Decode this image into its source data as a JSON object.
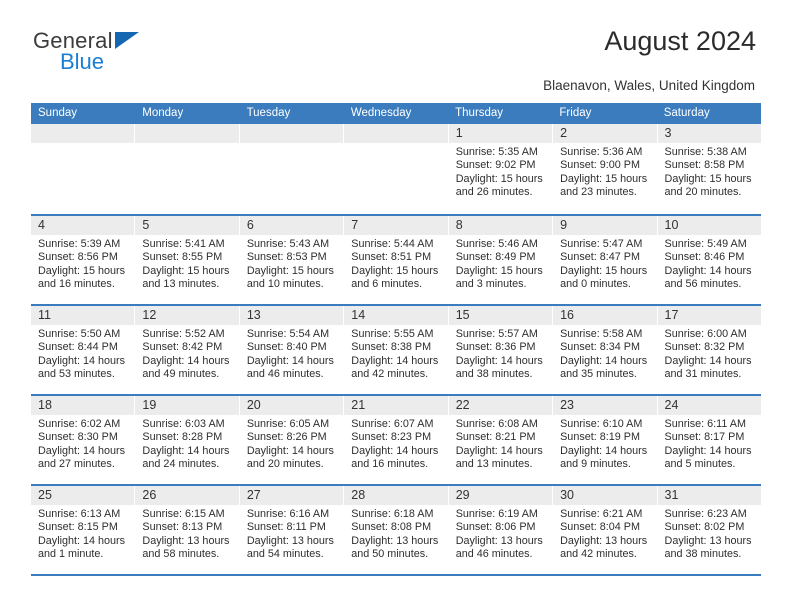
{
  "brand": {
    "name_top": "General",
    "name_bottom": "Blue",
    "triangle_icon": "blue-triangle-icon",
    "color_dark": "#3c3c3c",
    "color_blue": "#1a7fd4"
  },
  "header": {
    "title": "August 2024",
    "subtitle": "Blaenavon, Wales, United Kingdom"
  },
  "calendar": {
    "header_bg": "#3a7cbe",
    "day_band_bg": "#ececec",
    "day_names": [
      "Sunday",
      "Monday",
      "Tuesday",
      "Wednesday",
      "Thursday",
      "Friday",
      "Saturday"
    ],
    "weeks": [
      [
        {
          "day": "",
          "lines": []
        },
        {
          "day": "",
          "lines": []
        },
        {
          "day": "",
          "lines": []
        },
        {
          "day": "",
          "lines": []
        },
        {
          "day": "1",
          "lines": [
            "Sunrise: 5:35 AM",
            "Sunset: 9:02 PM",
            "Daylight: 15 hours",
            "and 26 minutes."
          ]
        },
        {
          "day": "2",
          "lines": [
            "Sunrise: 5:36 AM",
            "Sunset: 9:00 PM",
            "Daylight: 15 hours",
            "and 23 minutes."
          ]
        },
        {
          "day": "3",
          "lines": [
            "Sunrise: 5:38 AM",
            "Sunset: 8:58 PM",
            "Daylight: 15 hours",
            "and 20 minutes."
          ]
        }
      ],
      [
        {
          "day": "4",
          "lines": [
            "Sunrise: 5:39 AM",
            "Sunset: 8:56 PM",
            "Daylight: 15 hours",
            "and 16 minutes."
          ]
        },
        {
          "day": "5",
          "lines": [
            "Sunrise: 5:41 AM",
            "Sunset: 8:55 PM",
            "Daylight: 15 hours",
            "and 13 minutes."
          ]
        },
        {
          "day": "6",
          "lines": [
            "Sunrise: 5:43 AM",
            "Sunset: 8:53 PM",
            "Daylight: 15 hours",
            "and 10 minutes."
          ]
        },
        {
          "day": "7",
          "lines": [
            "Sunrise: 5:44 AM",
            "Sunset: 8:51 PM",
            "Daylight: 15 hours",
            "and 6 minutes."
          ]
        },
        {
          "day": "8",
          "lines": [
            "Sunrise: 5:46 AM",
            "Sunset: 8:49 PM",
            "Daylight: 15 hours",
            "and 3 minutes."
          ]
        },
        {
          "day": "9",
          "lines": [
            "Sunrise: 5:47 AM",
            "Sunset: 8:47 PM",
            "Daylight: 15 hours",
            "and 0 minutes."
          ]
        },
        {
          "day": "10",
          "lines": [
            "Sunrise: 5:49 AM",
            "Sunset: 8:46 PM",
            "Daylight: 14 hours",
            "and 56 minutes."
          ]
        }
      ],
      [
        {
          "day": "11",
          "lines": [
            "Sunrise: 5:50 AM",
            "Sunset: 8:44 PM",
            "Daylight: 14 hours",
            "and 53 minutes."
          ]
        },
        {
          "day": "12",
          "lines": [
            "Sunrise: 5:52 AM",
            "Sunset: 8:42 PM",
            "Daylight: 14 hours",
            "and 49 minutes."
          ]
        },
        {
          "day": "13",
          "lines": [
            "Sunrise: 5:54 AM",
            "Sunset: 8:40 PM",
            "Daylight: 14 hours",
            "and 46 minutes."
          ]
        },
        {
          "day": "14",
          "lines": [
            "Sunrise: 5:55 AM",
            "Sunset: 8:38 PM",
            "Daylight: 14 hours",
            "and 42 minutes."
          ]
        },
        {
          "day": "15",
          "lines": [
            "Sunrise: 5:57 AM",
            "Sunset: 8:36 PM",
            "Daylight: 14 hours",
            "and 38 minutes."
          ]
        },
        {
          "day": "16",
          "lines": [
            "Sunrise: 5:58 AM",
            "Sunset: 8:34 PM",
            "Daylight: 14 hours",
            "and 35 minutes."
          ]
        },
        {
          "day": "17",
          "lines": [
            "Sunrise: 6:00 AM",
            "Sunset: 8:32 PM",
            "Daylight: 14 hours",
            "and 31 minutes."
          ]
        }
      ],
      [
        {
          "day": "18",
          "lines": [
            "Sunrise: 6:02 AM",
            "Sunset: 8:30 PM",
            "Daylight: 14 hours",
            "and 27 minutes."
          ]
        },
        {
          "day": "19",
          "lines": [
            "Sunrise: 6:03 AM",
            "Sunset: 8:28 PM",
            "Daylight: 14 hours",
            "and 24 minutes."
          ]
        },
        {
          "day": "20",
          "lines": [
            "Sunrise: 6:05 AM",
            "Sunset: 8:26 PM",
            "Daylight: 14 hours",
            "and 20 minutes."
          ]
        },
        {
          "day": "21",
          "lines": [
            "Sunrise: 6:07 AM",
            "Sunset: 8:23 PM",
            "Daylight: 14 hours",
            "and 16 minutes."
          ]
        },
        {
          "day": "22",
          "lines": [
            "Sunrise: 6:08 AM",
            "Sunset: 8:21 PM",
            "Daylight: 14 hours",
            "and 13 minutes."
          ]
        },
        {
          "day": "23",
          "lines": [
            "Sunrise: 6:10 AM",
            "Sunset: 8:19 PM",
            "Daylight: 14 hours",
            "and 9 minutes."
          ]
        },
        {
          "day": "24",
          "lines": [
            "Sunrise: 6:11 AM",
            "Sunset: 8:17 PM",
            "Daylight: 14 hours",
            "and 5 minutes."
          ]
        }
      ],
      [
        {
          "day": "25",
          "lines": [
            "Sunrise: 6:13 AM",
            "Sunset: 8:15 PM",
            "Daylight: 14 hours",
            "and 1 minute."
          ]
        },
        {
          "day": "26",
          "lines": [
            "Sunrise: 6:15 AM",
            "Sunset: 8:13 PM",
            "Daylight: 13 hours",
            "and 58 minutes."
          ]
        },
        {
          "day": "27",
          "lines": [
            "Sunrise: 6:16 AM",
            "Sunset: 8:11 PM",
            "Daylight: 13 hours",
            "and 54 minutes."
          ]
        },
        {
          "day": "28",
          "lines": [
            "Sunrise: 6:18 AM",
            "Sunset: 8:08 PM",
            "Daylight: 13 hours",
            "and 50 minutes."
          ]
        },
        {
          "day": "29",
          "lines": [
            "Sunrise: 6:19 AM",
            "Sunset: 8:06 PM",
            "Daylight: 13 hours",
            "and 46 minutes."
          ]
        },
        {
          "day": "30",
          "lines": [
            "Sunrise: 6:21 AM",
            "Sunset: 8:04 PM",
            "Daylight: 13 hours",
            "and 42 minutes."
          ]
        },
        {
          "day": "31",
          "lines": [
            "Sunrise: 6:23 AM",
            "Sunset: 8:02 PM",
            "Daylight: 13 hours",
            "and 38 minutes."
          ]
        }
      ]
    ]
  }
}
